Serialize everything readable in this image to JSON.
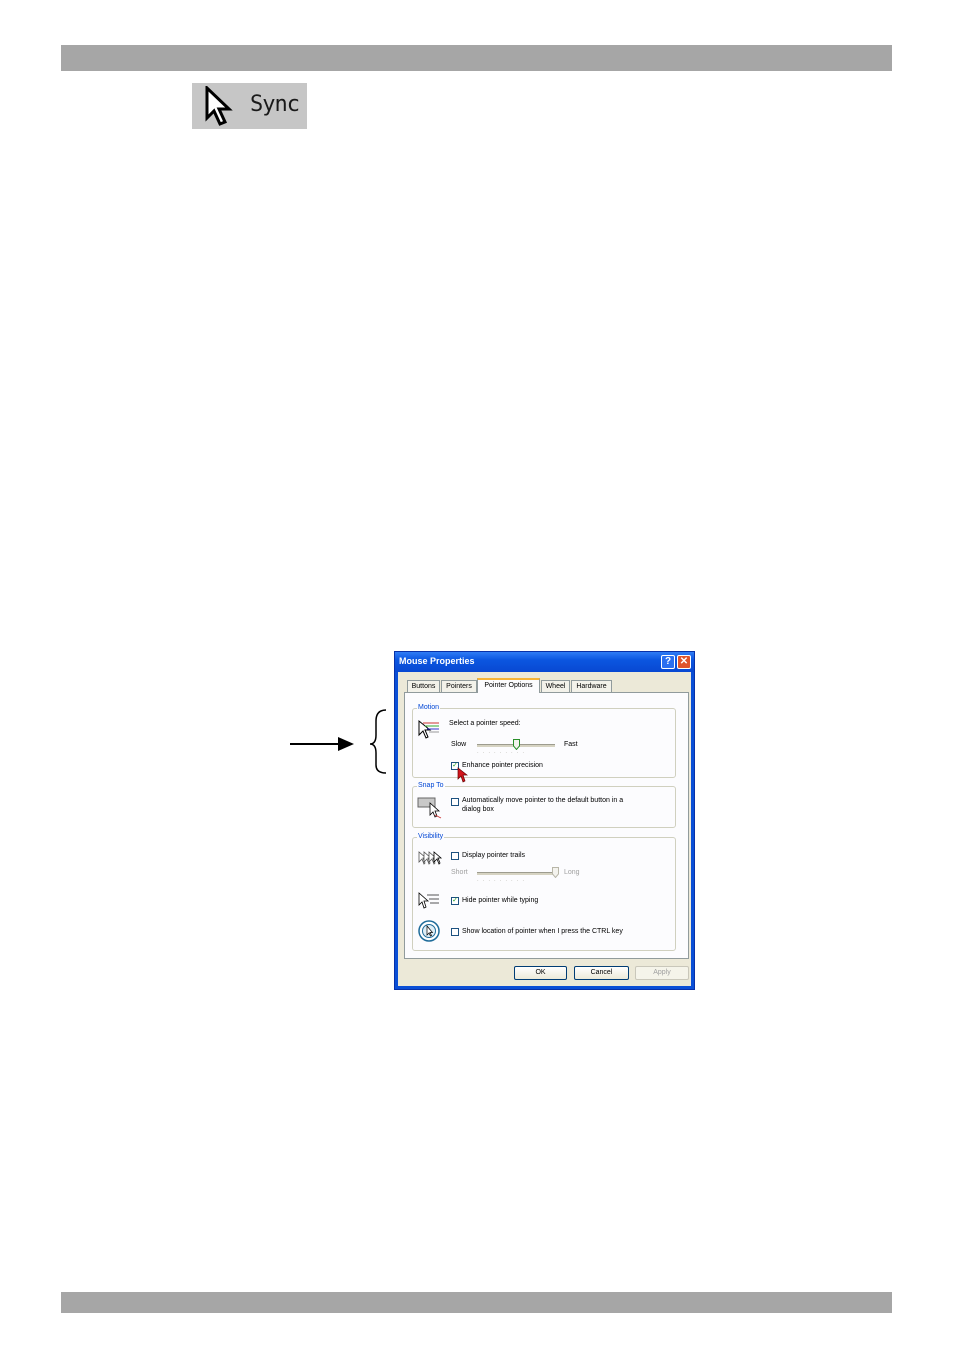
{
  "sync_button": {
    "label": "Sync",
    "icon": "arrow-pointer-icon"
  },
  "dialog": {
    "title": "Mouse Properties",
    "tabs": [
      "Buttons",
      "Pointers",
      "Pointer Options",
      "Wheel",
      "Hardware"
    ],
    "active_tab": "Pointer Options",
    "motion": {
      "group_label": "Motion",
      "prompt": "Select a pointer speed:",
      "slow_label": "Slow",
      "fast_label": "Fast",
      "speed_fraction": 0.5,
      "enhance_label": "Enhance pointer precision",
      "enhance_checked": true
    },
    "snap_to": {
      "group_label": "Snap To",
      "auto_move_label_line1": "Automatically move pointer to the default button in a",
      "auto_move_label_line2": "dialog box",
      "checked": false
    },
    "visibility": {
      "group_label": "Visibility",
      "trails_label": "Display pointer trails",
      "trails_checked": false,
      "short_label": "Short",
      "long_label": "Long",
      "trail_length_fraction": 1.0,
      "hide_label": "Hide pointer while typing",
      "hide_checked": true,
      "ctrl_label": "Show location of pointer when I press the CTRL key",
      "ctrl_checked": false
    },
    "buttons": {
      "ok": "OK",
      "cancel": "Cancel",
      "apply": "Apply"
    }
  },
  "colors": {
    "title_bar": "#0b56e0",
    "dialog_face": "#ece9d8",
    "group_label": "#0046d5",
    "page_bar": "#a6a6a6"
  }
}
